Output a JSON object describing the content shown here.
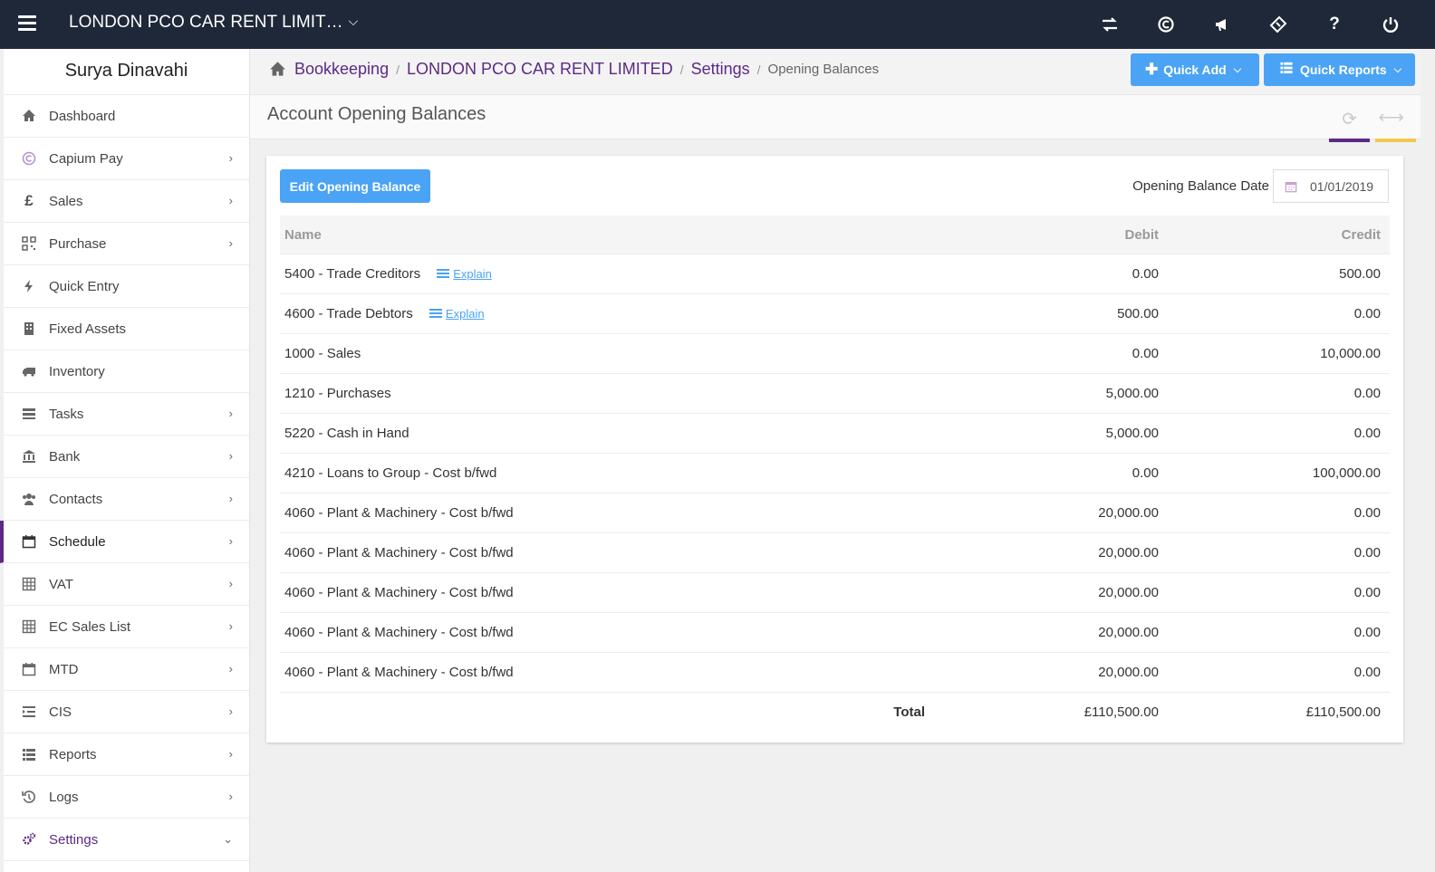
{
  "topbar": {
    "company": "LONDON PCO CAR RENT LIMIT…",
    "icons": [
      "switch-icon",
      "capium-icon",
      "announcement-icon",
      "ticket-icon",
      "help-icon",
      "power-icon"
    ],
    "help_glyph": "?"
  },
  "sidebar": {
    "user": "Surya Dinavahi",
    "items": [
      {
        "label": "Dashboard",
        "icon": "home-icon",
        "arrow": ""
      },
      {
        "label": "Capium Pay",
        "icon": "capium-pay-icon",
        "arrow": "›"
      },
      {
        "label": "Sales",
        "icon": "pound-icon",
        "arrow": "›"
      },
      {
        "label": "Purchase",
        "icon": "qrcode-icon",
        "arrow": "›"
      },
      {
        "label": "Quick Entry",
        "icon": "bolt-icon",
        "arrow": ""
      },
      {
        "label": "Fixed Assets",
        "icon": "building-icon",
        "arrow": ""
      },
      {
        "label": "Inventory",
        "icon": "truck-icon",
        "arrow": ""
      },
      {
        "label": "Tasks",
        "icon": "tasks-icon",
        "arrow": "›"
      },
      {
        "label": "Bank",
        "icon": "bank-icon",
        "arrow": "›"
      },
      {
        "label": "Contacts",
        "icon": "users-icon",
        "arrow": "›"
      },
      {
        "label": "Schedule",
        "icon": "calendar-icon",
        "arrow": "›"
      },
      {
        "label": "VAT",
        "icon": "calculator-icon",
        "arrow": "›"
      },
      {
        "label": "EC Sales List",
        "icon": "calculator-icon",
        "arrow": "›"
      },
      {
        "label": "MTD",
        "icon": "calendar-icon",
        "arrow": "›"
      },
      {
        "label": "CIS",
        "icon": "indent-icon",
        "arrow": "›"
      },
      {
        "label": "Reports",
        "icon": "list-icon",
        "arrow": "›"
      },
      {
        "label": "Logs",
        "icon": "history-icon",
        "arrow": "›"
      },
      {
        "label": "Settings",
        "icon": "cogs-icon",
        "arrow": "⌄"
      }
    ]
  },
  "breadcrumb": {
    "items": [
      "Bookkeeping",
      "LONDON PCO CAR RENT LIMITED",
      "Settings"
    ],
    "current": "Opening Balances",
    "separator": "/"
  },
  "quick": {
    "add_label": "Quick Add",
    "reports_label": "Quick Reports"
  },
  "page": {
    "title": "Account Opening Balances"
  },
  "card": {
    "edit_label": "Edit Opening Balance",
    "date_label": "Opening Balance Date",
    "date_value": "01/01/2019"
  },
  "table": {
    "headers": {
      "name": "Name",
      "debit": "Debit",
      "credit": "Credit"
    },
    "rows": [
      {
        "name": "5400 - Trade Creditors",
        "explain": "Explain",
        "debit": "0.00",
        "credit": "500.00"
      },
      {
        "name": "4600 - Trade Debtors",
        "explain": "Explain",
        "debit": "500.00",
        "credit": "0.00"
      },
      {
        "name": "1000 - Sales",
        "explain": "",
        "debit": "0.00",
        "credit": "10,000.00"
      },
      {
        "name": "1210 - Purchases",
        "explain": "",
        "debit": "5,000.00",
        "credit": "0.00"
      },
      {
        "name": "5220 - Cash in Hand",
        "explain": "",
        "debit": "5,000.00",
        "credit": "0.00"
      },
      {
        "name": "4210 - Loans to Group - Cost b/fwd",
        "explain": "",
        "debit": "0.00",
        "credit": "100,000.00"
      },
      {
        "name": "4060 - Plant & Machinery - Cost b/fwd",
        "explain": "",
        "debit": "20,000.00",
        "credit": "0.00"
      },
      {
        "name": "4060 - Plant & Machinery - Cost b/fwd",
        "explain": "",
        "debit": "20,000.00",
        "credit": "0.00"
      },
      {
        "name": "4060 - Plant & Machinery - Cost b/fwd",
        "explain": "",
        "debit": "20,000.00",
        "credit": "0.00"
      },
      {
        "name": "4060 - Plant & Machinery - Cost b/fwd",
        "explain": "",
        "debit": "20,000.00",
        "credit": "0.00"
      },
      {
        "name": "4060 - Plant & Machinery - Cost b/fwd",
        "explain": "",
        "debit": "20,000.00",
        "credit": "0.00"
      }
    ],
    "total": {
      "label": "Total",
      "debit": "£110,500.00",
      "credit": "£110,500.00"
    }
  },
  "colors": {
    "topbar": "#1f2838",
    "accent_purple": "#5b2a86",
    "accent_yellow": "#f2c94c",
    "button_blue": "#4aa3f4"
  }
}
